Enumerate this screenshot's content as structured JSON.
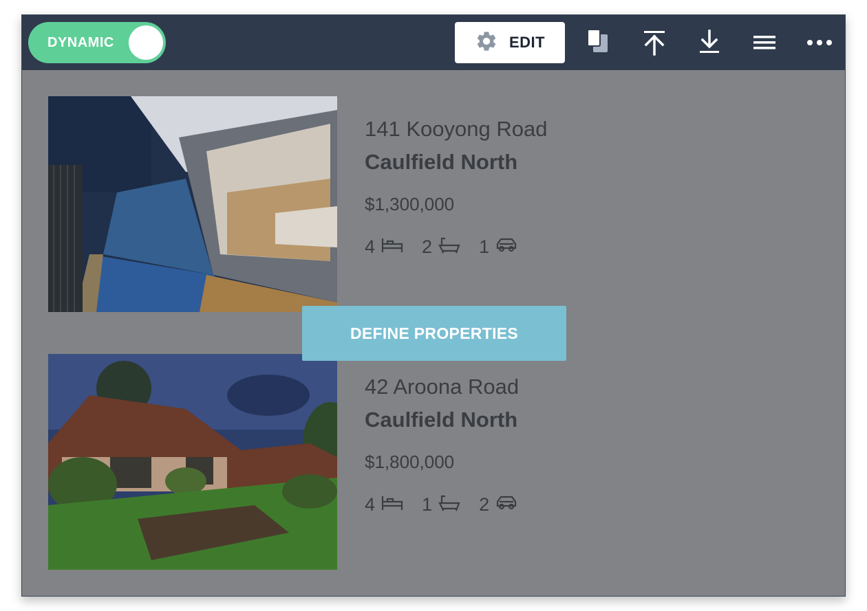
{
  "toolbar": {
    "toggle_label": "DYNAMIC",
    "edit_label": "EDIT",
    "icons": [
      "gear-icon",
      "duplicate-icon",
      "upload-icon",
      "download-icon",
      "menu-icon",
      "more-icon"
    ]
  },
  "overlay": {
    "define_label": "DEFINE PROPERTIES"
  },
  "listings": [
    {
      "street": "141 Kooyong Road",
      "suburb": "Caulfield North",
      "price": "$1,300,000",
      "beds": "4",
      "baths": "2",
      "cars": "1"
    },
    {
      "street": "42 Aroona Road",
      "suburb": "Caulfield North",
      "price": "$1,800,000",
      "beds": "4",
      "baths": "1",
      "cars": "2"
    }
  ],
  "colors": {
    "toolbar_bg": "#2f3b4c",
    "toggle_bg": "#5fcf98",
    "content_bg": "#818386",
    "define_button_bg": "#7bbfd2"
  }
}
